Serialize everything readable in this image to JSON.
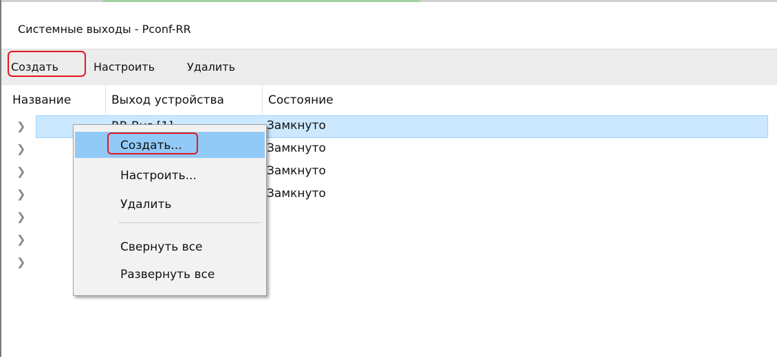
{
  "window": {
    "title": "Системные выходы - Pconf-RR"
  },
  "toolbar": {
    "create_label": "Создать",
    "configure_label": "Настроить",
    "delete_label": "Удалить"
  },
  "grid": {
    "columns": [
      "Название",
      "Выход устройства",
      "Состояние"
    ],
    "rows": [
      {
        "name": "RR Bus [1]",
        "state": "Замкнуто",
        "selected": true
      },
      {
        "name": "",
        "state": "Замкнуто",
        "selected": false
      },
      {
        "name": "",
        "state": "Замкнуто",
        "selected": false
      },
      {
        "name": "",
        "state": "Замкнуто",
        "selected": false
      },
      {
        "name": "",
        "state": "",
        "selected": false
      },
      {
        "name": "",
        "state": "",
        "selected": false
      },
      {
        "name": "",
        "state": "",
        "selected": false
      }
    ],
    "expander_icon": "chevron-right-icon"
  },
  "context_menu": {
    "items": [
      {
        "label": "Создать...",
        "highlighted": true
      },
      {
        "label": "Настроить..."
      },
      {
        "label": "Удалить"
      },
      {
        "label": "Свернуть все"
      },
      {
        "label": "Развернуть все"
      }
    ]
  },
  "colors": {
    "selection": "#cce8ff",
    "menu_highlight": "#91c9f7",
    "annotation_red": "#e3141e",
    "toolbar_bg": "#ececec"
  }
}
